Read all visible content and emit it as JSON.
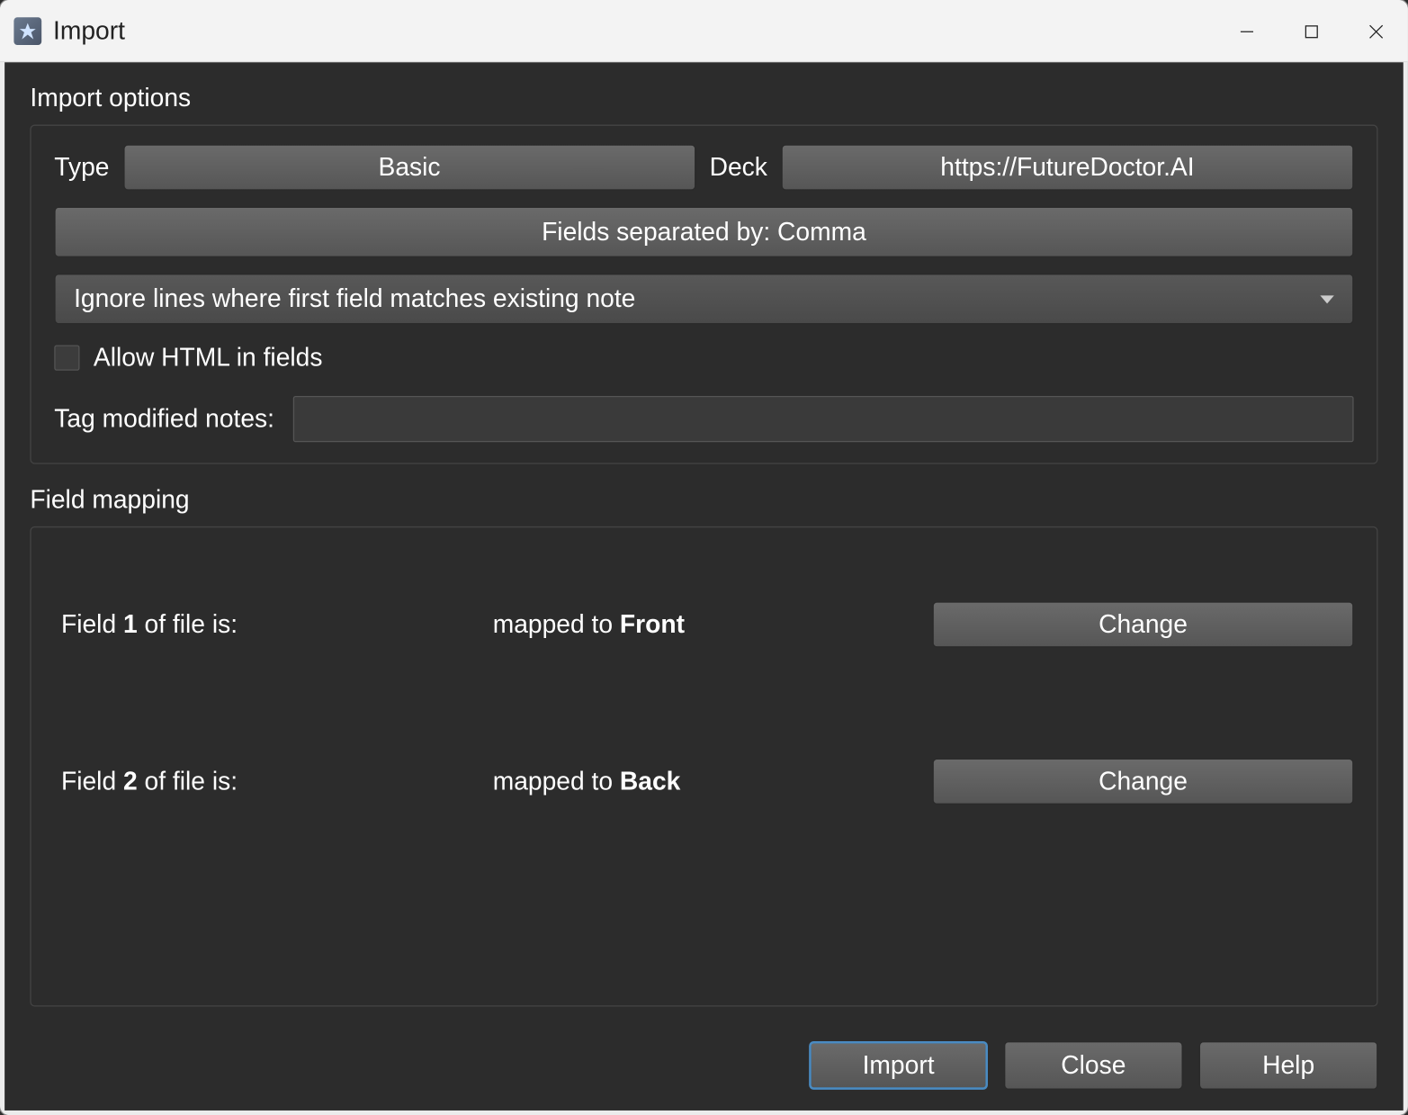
{
  "window": {
    "title": "Import"
  },
  "import_options": {
    "section_title": "Import options",
    "type_label": "Type",
    "type_value": "Basic",
    "deck_label": "Deck",
    "deck_value": "https://FutureDoctor.AI",
    "separator_button": "Fields separated by: Comma",
    "mode_dropdown": "Ignore lines where first field matches existing note",
    "allow_html_label": "Allow HTML in fields",
    "allow_html_checked": false,
    "tag_label": "Tag modified notes:",
    "tag_value": ""
  },
  "field_mapping": {
    "section_title": "Field mapping",
    "rows": [
      {
        "prefix": "Field ",
        "num": "1",
        "suffix": " of file is:",
        "mapped_prefix": "mapped to ",
        "mapped_value": "Front",
        "change_label": "Change"
      },
      {
        "prefix": "Field ",
        "num": "2",
        "suffix": " of file is:",
        "mapped_prefix": "mapped to ",
        "mapped_value": "Back",
        "change_label": "Change"
      }
    ]
  },
  "footer": {
    "import_label": "Import",
    "close_label": "Close",
    "help_label": "Help"
  }
}
